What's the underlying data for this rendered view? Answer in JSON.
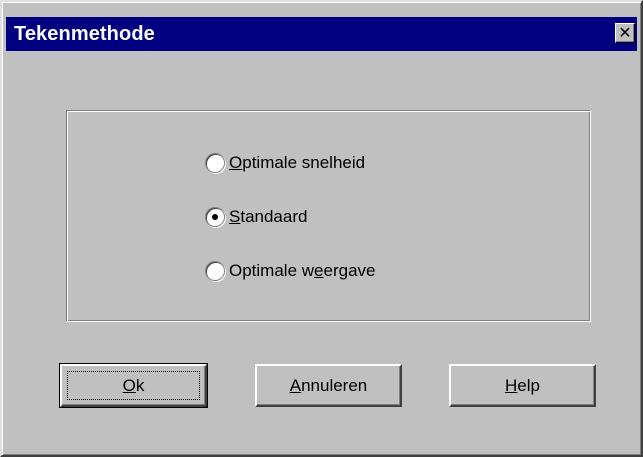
{
  "dialog": {
    "title": "Tekenmethode",
    "close_glyph": "✕"
  },
  "options": [
    {
      "label": "Optimale snelheid",
      "accel_index": 0,
      "checked": false
    },
    {
      "label": "Standaard",
      "accel_index": 0,
      "checked": true
    },
    {
      "label": "Optimale weergave",
      "accel_index": 10,
      "checked": false
    }
  ],
  "buttons": {
    "ok": {
      "label": "Ok",
      "accel_index": 0
    },
    "cancel": {
      "label": "Annuleren",
      "accel_index": 0
    },
    "help": {
      "label": "Help",
      "accel_index": 0
    }
  },
  "colors": {
    "titlebar": "#000080",
    "face": "#c0c0c0"
  },
  "icons": {
    "close": "close-icon"
  }
}
